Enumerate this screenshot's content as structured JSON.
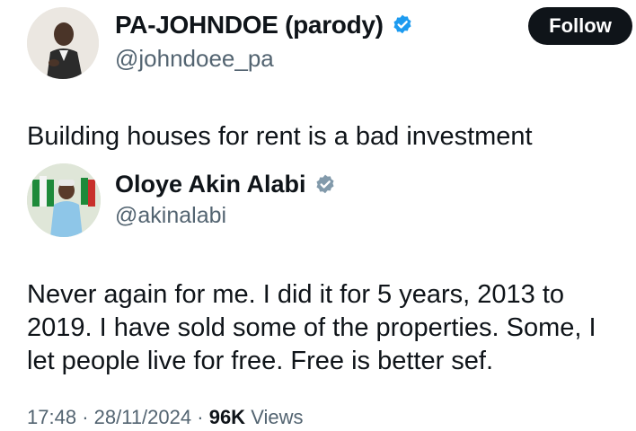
{
  "author": {
    "display_name": "PA-JOHNDOE (parody)",
    "handle": "@johndoee_pa",
    "verified_icon": "verified-badge-icon",
    "verified_color": "#1d9bf0"
  },
  "follow_button": {
    "label": "Follow"
  },
  "tweet": {
    "text": "Building houses for rent is a bad investment"
  },
  "quoted": {
    "display_name": "Oloye Akin Alabi",
    "handle": "@akinalabi",
    "verified_icon": "verified-badge-icon",
    "verified_color": "#829aab",
    "body_lines": [
      "Never again for me. I did it for 5 years, 2013 to",
      "2019. I have sold some of the properties. Some, I",
      "let people live for free. Free is better sef."
    ]
  },
  "meta": {
    "time": "17:48",
    "date": "28/11/2024",
    "separator": "·",
    "views_count": "96K",
    "views_label": "Views"
  }
}
